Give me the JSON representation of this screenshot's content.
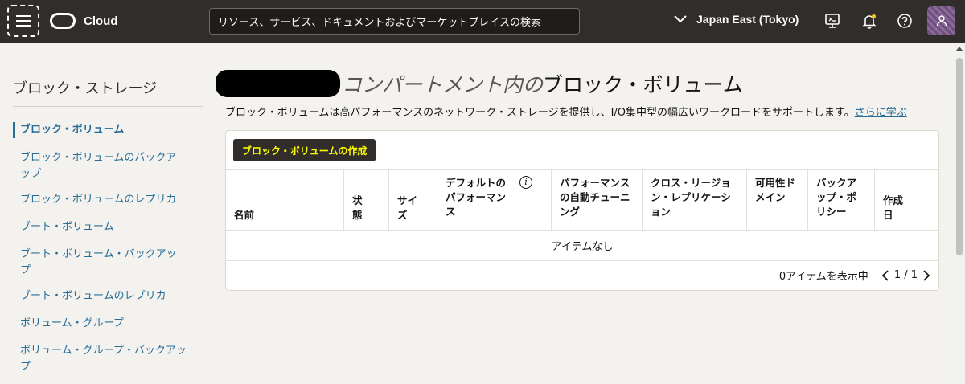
{
  "header": {
    "brand": "Cloud",
    "search_placeholder": "リソース、サービス、ドキュメントおよびマーケットプレイスの検索",
    "region": "Japan East (Tokyo)"
  },
  "sidebar": {
    "title": "ブロック・ストレージ",
    "items": [
      {
        "label": "ブロック・ボリューム"
      },
      {
        "label": "ブロック・ボリュームのバックアップ"
      },
      {
        "label": "ブロック・ボリュームのレプリカ"
      },
      {
        "label": "ブート・ボリューム"
      },
      {
        "label": "ブート・ボリューム・バックアップ"
      },
      {
        "label": "ブート・ボリュームのレプリカ"
      },
      {
        "label": "ボリューム・グループ"
      },
      {
        "label": "ボリューム・グループ・バックアップ"
      }
    ]
  },
  "main": {
    "title_italic": "コンパートメント内の",
    "title": "ブロック・ボリューム",
    "description": "ブロック・ボリュームは高パフォーマンスのネットワーク・ストレージを提供し、I/O集中型の幅広いワークロードをサポートします。",
    "learn_more": "さらに学ぶ",
    "create_button": "ブロック・ボリュームの作成",
    "columns": [
      "名前",
      "状態",
      "サイズ",
      "デフォルトのパフォーマンス",
      "パフォーマンスの自動チューニング",
      "クロス・リージョン・レプリケーション",
      "可用性ドメイン",
      "バックアップ・ポリシー",
      "作成日"
    ],
    "empty_text": "アイテムなし",
    "footer_count": "0アイテムを表示中",
    "pagination": "1 / 1"
  },
  "colors": {
    "header_bg": "#312d2a",
    "link": "#276d96",
    "button_text": "#ffff00"
  }
}
